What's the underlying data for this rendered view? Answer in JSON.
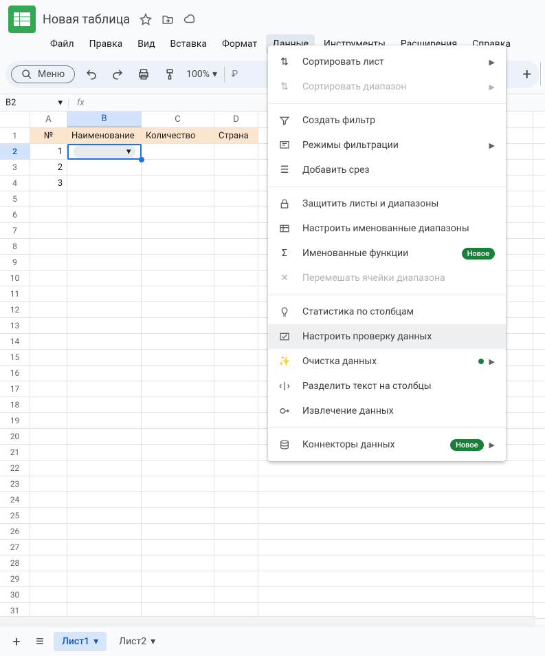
{
  "doc": {
    "title": "Новая таблица"
  },
  "menus": {
    "file": "Файл",
    "edit": "Правка",
    "view": "Вид",
    "insert": "Вставка",
    "format": "Формат",
    "data": "Данные",
    "tools": "Инструменты",
    "extensions": "Расширения",
    "help": "Справка"
  },
  "toolbar": {
    "menu_button": "Меню",
    "zoom": "100%"
  },
  "namebox": {
    "ref": "B2"
  },
  "columns": {
    "a": "A",
    "b": "B",
    "c": "C",
    "d": "D"
  },
  "headers": {
    "a": "№",
    "b": "Наименование",
    "c": "Количество",
    "d": "Страна"
  },
  "rows_numbered": {
    "r1": "1",
    "r2": "2",
    "r3": "3"
  },
  "data_menu": {
    "sort_sheet": "Сортировать лист",
    "sort_range": "Сортировать диапазон",
    "create_filter": "Создать фильтр",
    "filter_views": "Режимы фильтрации",
    "add_slicer": "Добавить срез",
    "protect": "Защитить листы и диапазоны",
    "named_ranges": "Настроить именованные диапазоны",
    "named_functions": "Именованные функции",
    "randomize": "Перемешать ячейки диапазона",
    "column_stats": "Статистика по столбцам",
    "data_validation": "Настроить проверку данных",
    "data_cleanup": "Очистка данных",
    "split_text": "Разделить текст на столбцы",
    "data_extraction": "Извлечение данных",
    "data_connectors": "Коннекторы данных",
    "badge_new": "Новое"
  },
  "sheets": {
    "s1": "Лист1",
    "s2": "Лист2"
  }
}
